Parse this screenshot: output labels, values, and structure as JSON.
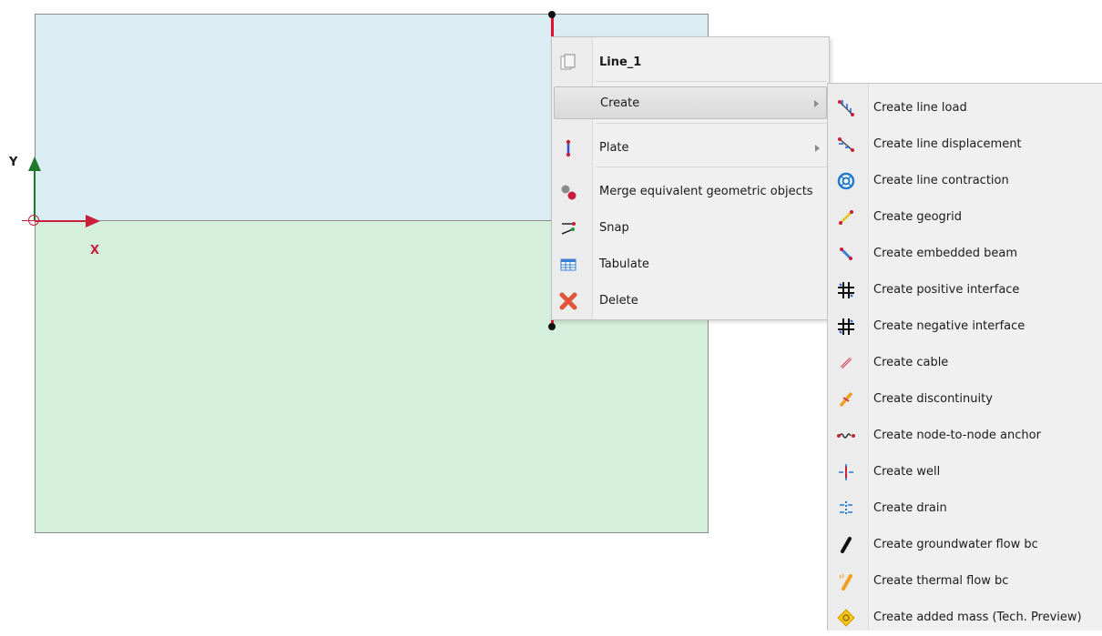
{
  "viewport": {
    "axis_x_label": "X",
    "axis_y_label": "Y",
    "colors": {
      "soil_top": "#daedf2",
      "soil_bottom": "#d4efdc",
      "selected_line": "#e0102e",
      "x_axis": "#c8203c",
      "y_axis": "#1f7a2e"
    }
  },
  "context_menu": {
    "header": {
      "label": "Line_1",
      "icon": "document-icon"
    },
    "items": [
      {
        "label": "Create",
        "icon": "",
        "has_submenu": true,
        "highlighted": true
      },
      {
        "label": "Plate",
        "icon": "plate-icon",
        "has_submenu": true
      },
      {
        "label": "Merge equivalent geometric objects",
        "icon": "merge-icon",
        "has_submenu": false
      },
      {
        "label": "Snap",
        "icon": "snap-icon",
        "has_submenu": false
      },
      {
        "label": "Tabulate",
        "icon": "table-icon",
        "has_submenu": false
      },
      {
        "label": "Delete",
        "icon": "delete-x-icon",
        "has_submenu": false
      }
    ]
  },
  "create_submenu": {
    "items": [
      {
        "label": "Create line load",
        "icon": "line-load-icon"
      },
      {
        "label": "Create line displacement",
        "icon": "line-displacement-icon"
      },
      {
        "label": "Create line contraction",
        "icon": "line-contraction-icon"
      },
      {
        "label": "Create geogrid",
        "icon": "geogrid-icon"
      },
      {
        "label": "Create embedded beam",
        "icon": "embedded-beam-icon"
      },
      {
        "label": "Create positive interface",
        "icon": "positive-interface-icon"
      },
      {
        "label": "Create negative interface",
        "icon": "negative-interface-icon"
      },
      {
        "label": "Create cable",
        "icon": "cable-icon"
      },
      {
        "label": "Create discontinuity",
        "icon": "discontinuity-icon"
      },
      {
        "label": "Create node-to-node anchor",
        "icon": "node-to-node-anchor-icon"
      },
      {
        "label": "Create well",
        "icon": "well-icon"
      },
      {
        "label": "Create drain",
        "icon": "drain-icon"
      },
      {
        "label": "Create groundwater flow bc",
        "icon": "groundwater-flow-bc-icon"
      },
      {
        "label": "Create thermal flow bc",
        "icon": "thermal-flow-bc-icon"
      },
      {
        "label": "Create added mass (Tech. Preview)",
        "icon": "added-mass-icon"
      }
    ]
  }
}
